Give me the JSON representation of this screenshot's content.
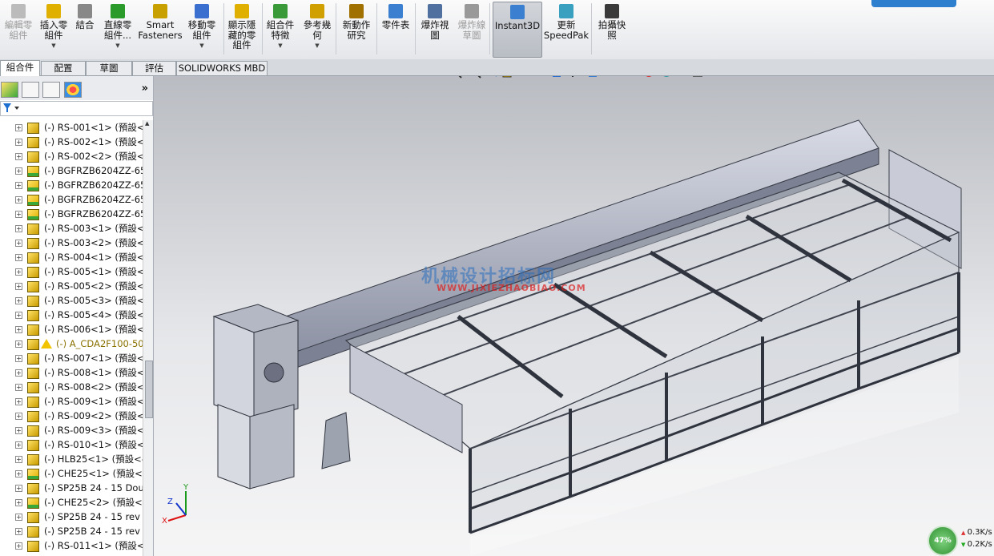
{
  "ribbon": {
    "top_button": "",
    "buttons": [
      {
        "label": "編輯零\n組件",
        "icon": "edit-component-icon",
        "disabled": true,
        "dropdown": false
      },
      {
        "label": "插入零\n組件",
        "icon": "insert-component-icon",
        "disabled": false,
        "dropdown": true
      },
      {
        "label": "結合",
        "icon": "mate-icon",
        "disabled": false,
        "dropdown": false
      },
      {
        "label": "直線零\n組件...",
        "icon": "linear-pattern-icon",
        "disabled": false,
        "dropdown": true
      },
      {
        "label": "Smart\nFasteners",
        "icon": "smart-fasteners-icon",
        "disabled": false,
        "dropdown": false
      },
      {
        "label": "移動零\n組件",
        "icon": "move-component-icon",
        "disabled": false,
        "dropdown": true
      },
      {
        "label": "顯示隱\n藏的零\n組件",
        "icon": "show-hidden-icon",
        "disabled": false,
        "dropdown": false
      },
      {
        "label": "組合件\n特徵",
        "icon": "assembly-features-icon",
        "disabled": false,
        "dropdown": true
      },
      {
        "label": "參考幾\n何",
        "icon": "reference-geometry-icon",
        "disabled": false,
        "dropdown": true
      },
      {
        "label": "新動作\n研究",
        "icon": "motion-study-icon",
        "disabled": false,
        "dropdown": false
      },
      {
        "label": "零件表",
        "icon": "bom-icon",
        "disabled": false,
        "dropdown": false
      },
      {
        "label": "爆炸視\n圖",
        "icon": "exploded-view-icon",
        "disabled": false,
        "dropdown": false
      },
      {
        "label": "爆炸線\n草圖",
        "icon": "explode-line-icon",
        "disabled": true,
        "dropdown": false
      },
      {
        "label": "Instant3D",
        "icon": "instant3d-icon",
        "disabled": false,
        "dropdown": false
      },
      {
        "label": "更新\nSpeedPak",
        "icon": "speedpak-icon",
        "disabled": false,
        "dropdown": false
      },
      {
        "label": "拍攝快\n照",
        "icon": "snapshot-icon",
        "disabled": false,
        "dropdown": false
      }
    ]
  },
  "tabs": [
    "組合件",
    "配置",
    "草圖",
    "評估",
    "SOLIDWORKS MBD"
  ],
  "tree": [
    {
      "text": "(-) RS-001<1> (預設<",
      "icon": "part"
    },
    {
      "text": "(-) RS-002<1> (預設<",
      "icon": "part"
    },
    {
      "text": "(-) RS-002<2> (預設<",
      "icon": "part"
    },
    {
      "text": "(-) BGFRZB6204ZZ-65",
      "icon": "part-green"
    },
    {
      "text": "(-) BGFRZB6204ZZ-65",
      "icon": "part-green"
    },
    {
      "text": "(-) BGFRZB6204ZZ-65",
      "icon": "part-green"
    },
    {
      "text": "(-) BGFRZB6204ZZ-65",
      "icon": "part-green"
    },
    {
      "text": "(-) RS-003<1> (預設<",
      "icon": "part"
    },
    {
      "text": "(-) RS-003<2> (預設<",
      "icon": "part"
    },
    {
      "text": "(-) RS-004<1> (預設<",
      "icon": "part"
    },
    {
      "text": "(-) RS-005<1> (預設<",
      "icon": "part"
    },
    {
      "text": "(-) RS-005<2> (預設<",
      "icon": "part"
    },
    {
      "text": "(-) RS-005<3> (預設<",
      "icon": "part"
    },
    {
      "text": "(-) RS-005<4> (預設<",
      "icon": "part"
    },
    {
      "text": "(-) RS-006<1> (預設<",
      "icon": "part"
    },
    {
      "text": "(-) A_CDA2F100-50",
      "icon": "warning"
    },
    {
      "text": "(-) RS-007<1> (預設<",
      "icon": "part"
    },
    {
      "text": "(-) RS-008<1> (預設<",
      "icon": "part"
    },
    {
      "text": "(-) RS-008<2> (預設<",
      "icon": "part"
    },
    {
      "text": "(-) RS-009<1> (預設<",
      "icon": "part"
    },
    {
      "text": "(-) RS-009<2> (預設<",
      "icon": "part"
    },
    {
      "text": "(-) RS-009<3> (預設<",
      "icon": "part"
    },
    {
      "text": "(-) RS-010<1> (預設<",
      "icon": "part"
    },
    {
      "text": "(-) HLB25<1> (預設<-",
      "icon": "part"
    },
    {
      "text": "(-) CHE25<1> (預設<",
      "icon": "part-green"
    },
    {
      "text": "(-) SP25B 24 - 15 Dou",
      "icon": "part"
    },
    {
      "text": "(-) CHE25<2> (預設<",
      "icon": "part-green"
    },
    {
      "text": "(-) SP25B 24 - 15 rev 1",
      "icon": "part"
    },
    {
      "text": "(-) SP25B 24 - 15 rev 1",
      "icon": "part"
    },
    {
      "text": "(-) RS-011<1> (預設<",
      "icon": "part"
    }
  ],
  "graphics": {
    "watermark": "机械设计招标网",
    "watermark_url": "WWW.JIXIEZHAOBIAO.COM",
    "triad": {
      "x": "X",
      "y": "Y",
      "z": "Z"
    }
  },
  "net_meter": {
    "percent": "47%",
    "up": "0.3K/s",
    "down": "0.2K/s"
  },
  "colors": {
    "accent": "#2f7fcf",
    "frame": "#8a8e98",
    "tree_icon": "#e0b000"
  }
}
